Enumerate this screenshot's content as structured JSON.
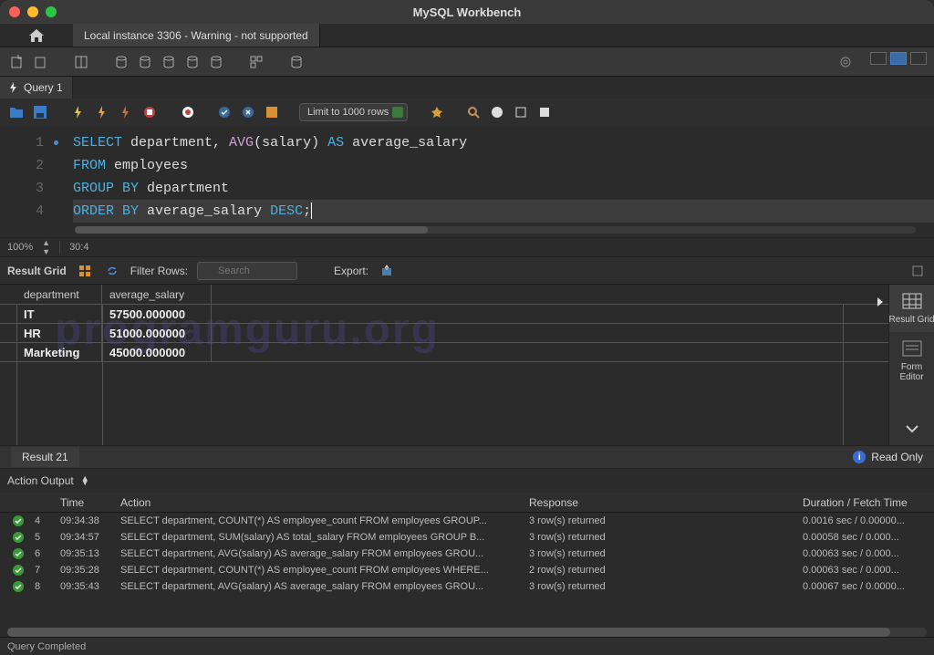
{
  "window": {
    "title": "MySQL Workbench"
  },
  "connection_tab": "Local instance 3306 - Warning - not supported",
  "query_tab": "Query 1",
  "limit_select": "Limit to 1000 rows",
  "editor": {
    "lines": [
      {
        "n": "1",
        "marked": true,
        "tokens": [
          [
            "kw",
            "SELECT"
          ],
          [
            "",
            " department, "
          ],
          [
            "fn",
            "AVG"
          ],
          [
            "",
            "(salary) "
          ],
          [
            "kw",
            "AS"
          ],
          [
            "",
            " average_salary"
          ]
        ]
      },
      {
        "n": "2",
        "tokens": [
          [
            "kw",
            "FROM"
          ],
          [
            "",
            " employees"
          ]
        ]
      },
      {
        "n": "3",
        "tokens": [
          [
            "kw",
            "GROUP"
          ],
          [
            "",
            " "
          ],
          [
            "kw",
            "BY"
          ],
          [
            "",
            " department"
          ]
        ]
      },
      {
        "n": "4",
        "active": true,
        "tokens": [
          [
            "kw",
            "ORDER"
          ],
          [
            "",
            " "
          ],
          [
            "kw",
            "BY"
          ],
          [
            "",
            " average_salary "
          ],
          [
            "kw",
            "DESC"
          ],
          [
            "",
            ";"
          ]
        ]
      }
    ],
    "zoom": "100%",
    "cursor": "30:4"
  },
  "result_bar": {
    "label": "Result Grid",
    "filter_label": "Filter Rows:",
    "search_placeholder": "Search",
    "export_label": "Export:"
  },
  "grid": {
    "headers": [
      "department",
      "average_salary"
    ],
    "rows": [
      [
        "IT",
        "57500.000000"
      ],
      [
        "HR",
        "51000.000000"
      ],
      [
        "Marketing",
        "45000.000000"
      ]
    ]
  },
  "side_tabs": {
    "result_grid": "Result Grid",
    "form_editor": "Form Editor"
  },
  "result_tab": "Result 21",
  "readonly": "Read Only",
  "watermark": "programguru.org",
  "output": {
    "label": "Action Output",
    "columns": {
      "time": "Time",
      "action": "Action",
      "response": "Response",
      "duration": "Duration / Fetch Time"
    },
    "rows": [
      {
        "n": "4",
        "time": "09:34:38",
        "action": "SELECT department, COUNT(*) AS employee_count FROM employees GROUP...",
        "resp": "3 row(s) returned",
        "dur": "0.0016 sec / 0.00000..."
      },
      {
        "n": "5",
        "time": "09:34:57",
        "action": "SELECT department, SUM(salary) AS total_salary FROM employees GROUP B...",
        "resp": "3 row(s) returned",
        "dur": "0.00058 sec / 0.000..."
      },
      {
        "n": "6",
        "time": "09:35:13",
        "action": "SELECT department, AVG(salary) AS average_salary FROM employees GROU...",
        "resp": "3 row(s) returned",
        "dur": "0.00063 sec / 0.000..."
      },
      {
        "n": "7",
        "time": "09:35:28",
        "action": "SELECT department, COUNT(*) AS employee_count FROM employees WHERE...",
        "resp": "2 row(s) returned",
        "dur": "0.00063 sec / 0.000..."
      },
      {
        "n": "8",
        "time": "09:35:43",
        "action": "SELECT department, AVG(salary) AS average_salary FROM employees GROU...",
        "resp": "3 row(s) returned",
        "dur": "0.00067 sec / 0.0000..."
      }
    ]
  },
  "status": "Query Completed"
}
